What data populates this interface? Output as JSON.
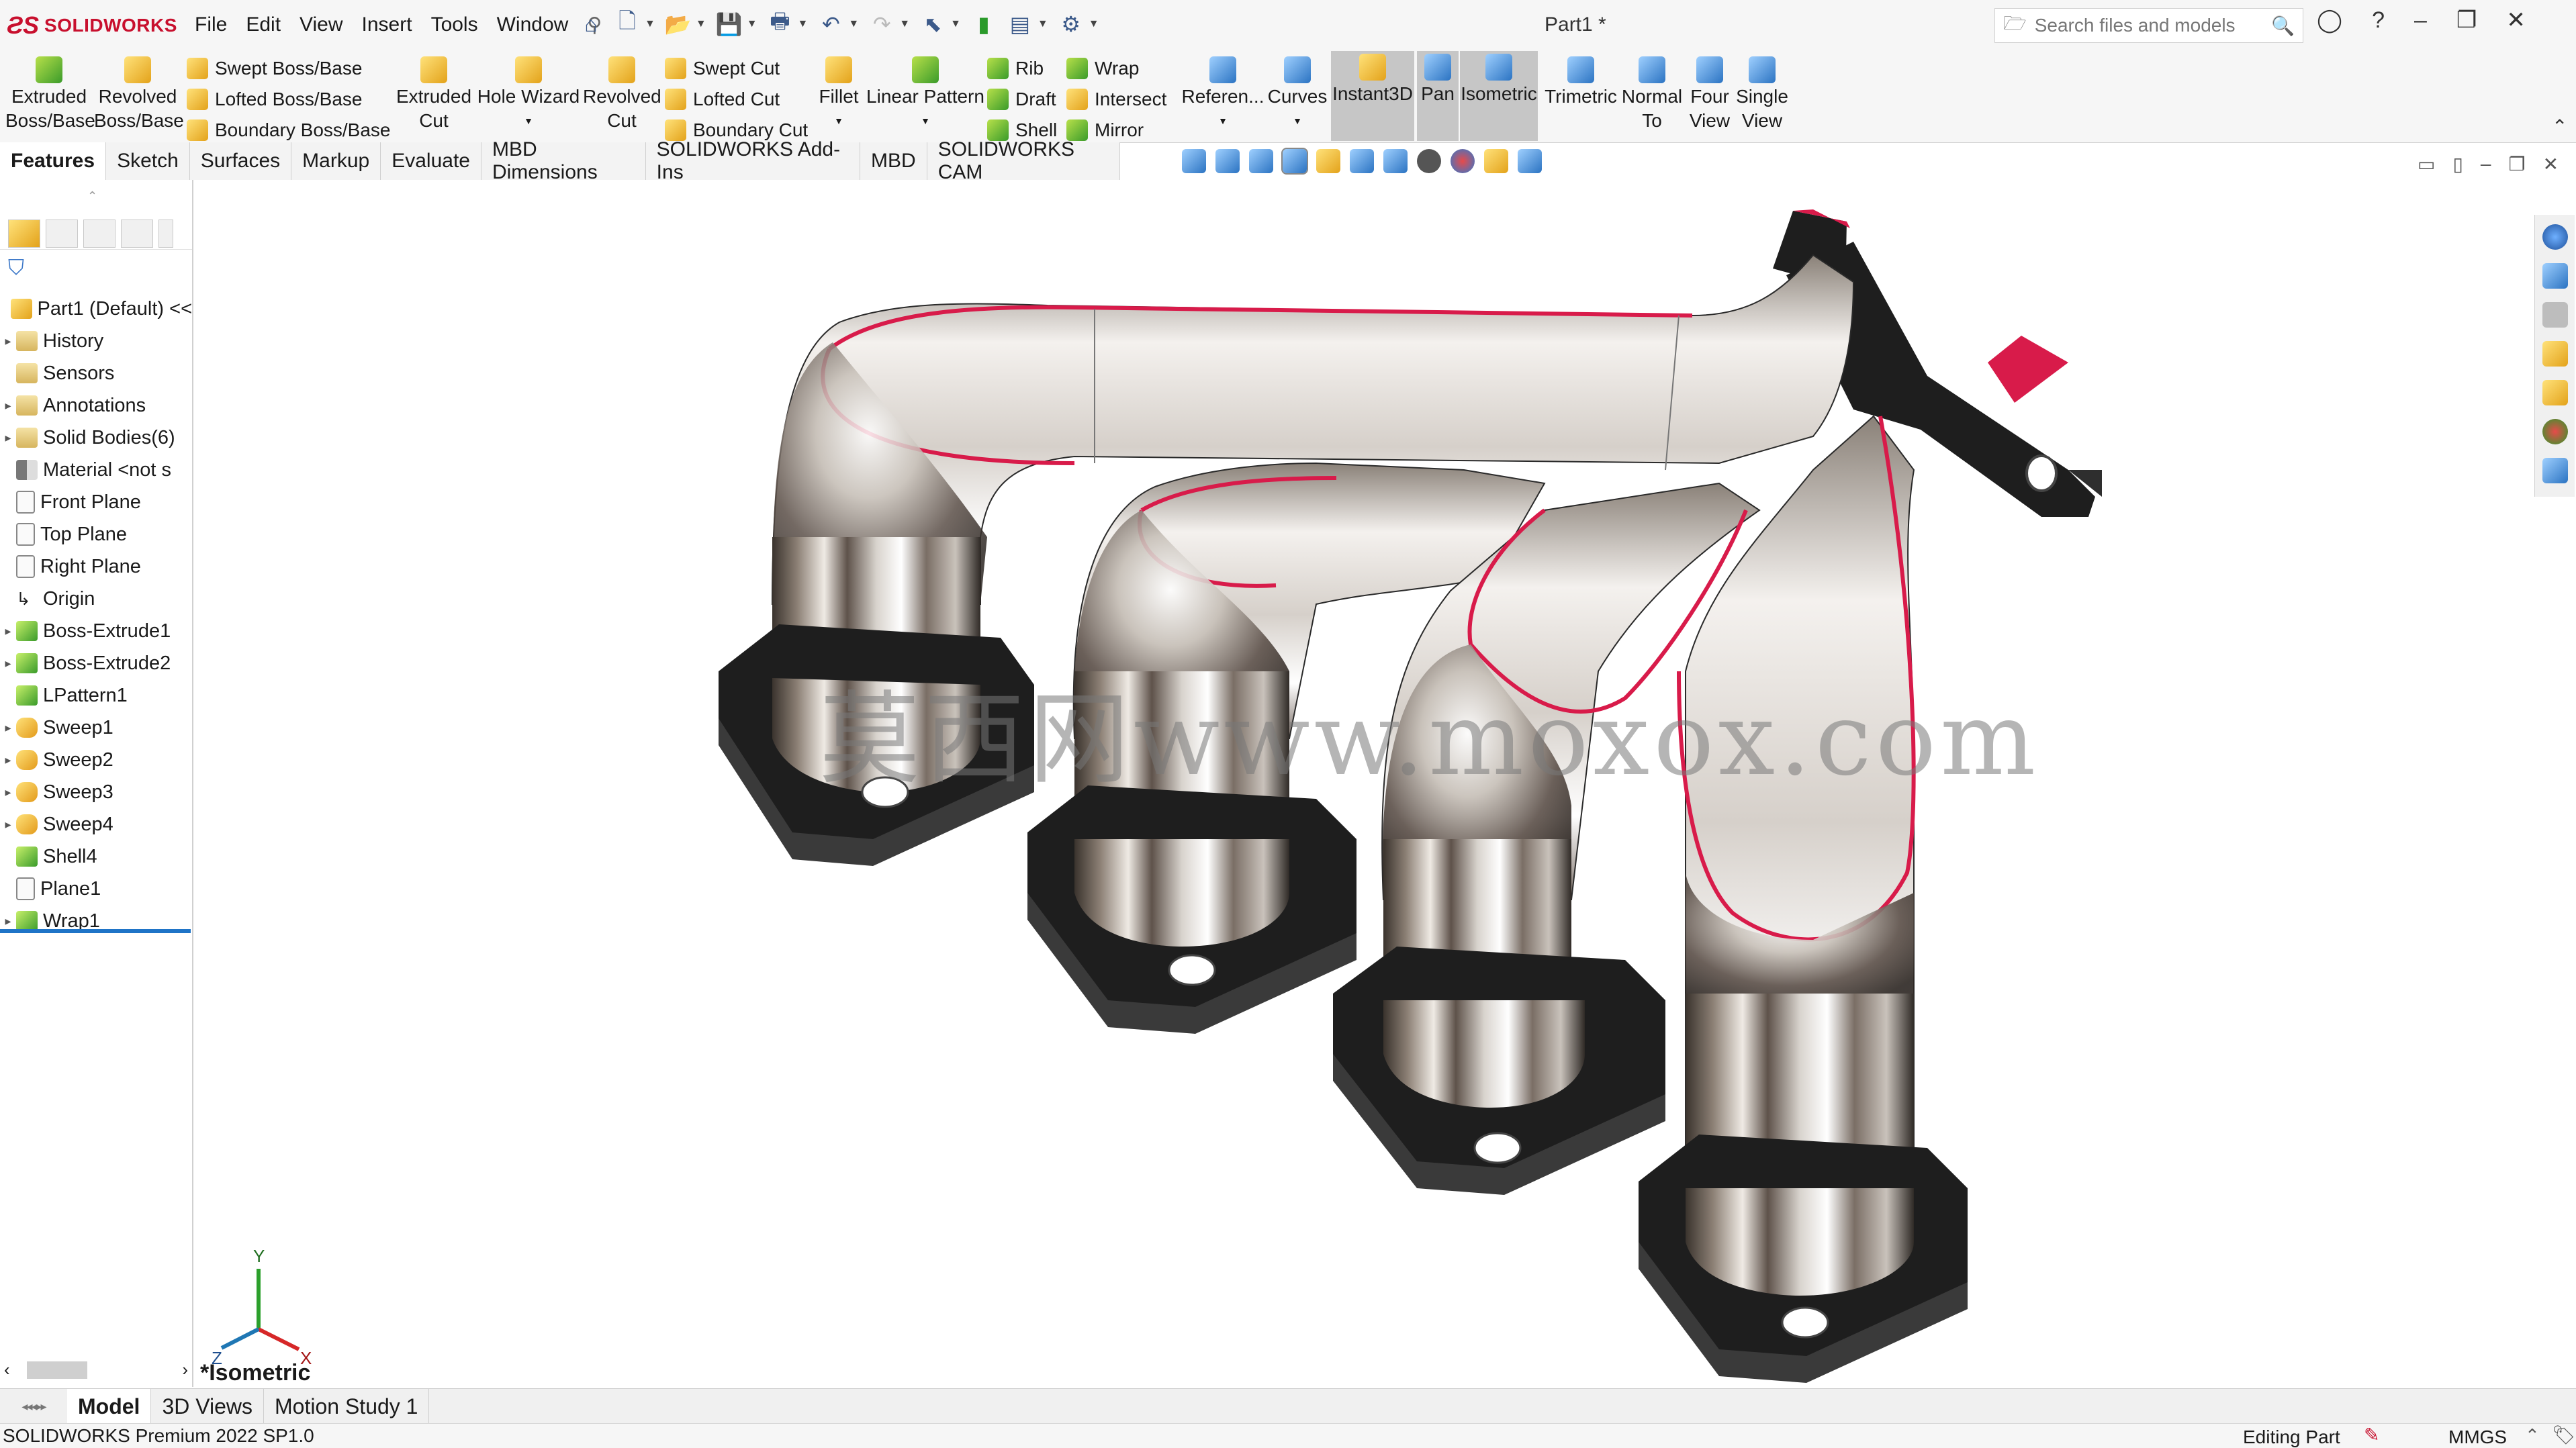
{
  "app": {
    "brand": "SOLIDWORKS",
    "doc_title": "Part1 *"
  },
  "menu": [
    "File",
    "Edit",
    "View",
    "Insert",
    "Tools",
    "Window"
  ],
  "search": {
    "placeholder": "Search files and models"
  },
  "commands": {
    "extruded_boss": "Extruded\nBoss/Base",
    "revolved_boss": "Revolved\nBoss/Base",
    "swept_boss": "Swept Boss/Base",
    "lofted_boss": "Lofted Boss/Base",
    "boundary_boss": "Boundary Boss/Base",
    "extruded_cut": "Extruded\nCut",
    "hole_wizard": "Hole Wizard",
    "revolved_cut": "Revolved\nCut",
    "swept_cut": "Swept Cut",
    "lofted_cut": "Lofted Cut",
    "boundary_cut": "Boundary Cut",
    "fillet": "Fillet",
    "linear_pattern": "Linear Pattern",
    "rib": "Rib",
    "draft": "Draft",
    "shell": "Shell",
    "wrap": "Wrap",
    "intersect": "Intersect",
    "mirror": "Mirror",
    "reference": "Referen...",
    "curves": "Curves",
    "instant3d": "Instant3D",
    "pan": "Pan",
    "isometric": "Isometric",
    "trimetric": "Trimetric",
    "normal_to": "Normal\nTo",
    "four_view": "Four\nView",
    "single_view": "Single\nView"
  },
  "tabs": [
    "Features",
    "Sketch",
    "Surfaces",
    "Markup",
    "Evaluate",
    "MBD Dimensions",
    "SOLIDWORKS Add-Ins",
    "MBD",
    "SOLIDWORKS CAM"
  ],
  "tree": {
    "root": "Part1 (Default) <<",
    "items": [
      "History",
      "Sensors",
      "Annotations",
      "Solid Bodies(6)",
      "Material <not s",
      "Front Plane",
      "Top Plane",
      "Right Plane",
      "Origin",
      "Boss-Extrude1",
      "Boss-Extrude2",
      "LPattern1",
      "Sweep1",
      "Sweep2",
      "Sweep3",
      "Sweep4",
      "Shell4",
      "Plane1",
      "Wrap1"
    ]
  },
  "viewport": {
    "view_name": "*Isometric",
    "watermark": "莫西网www.moxox.com",
    "triad": {
      "x": "X",
      "y": "Y",
      "z": "Z"
    }
  },
  "bottom_tabs": [
    "Model",
    "3D Views",
    "Motion Study 1"
  ],
  "status": {
    "left": "SOLIDWORKS Premium 2022 SP1.0",
    "mode": "Editing Part",
    "units": "MMGS"
  },
  "colors": {
    "brand_red": "#c8102e",
    "cut_face": "#d81b4a",
    "flange": "#1e1e1e"
  }
}
